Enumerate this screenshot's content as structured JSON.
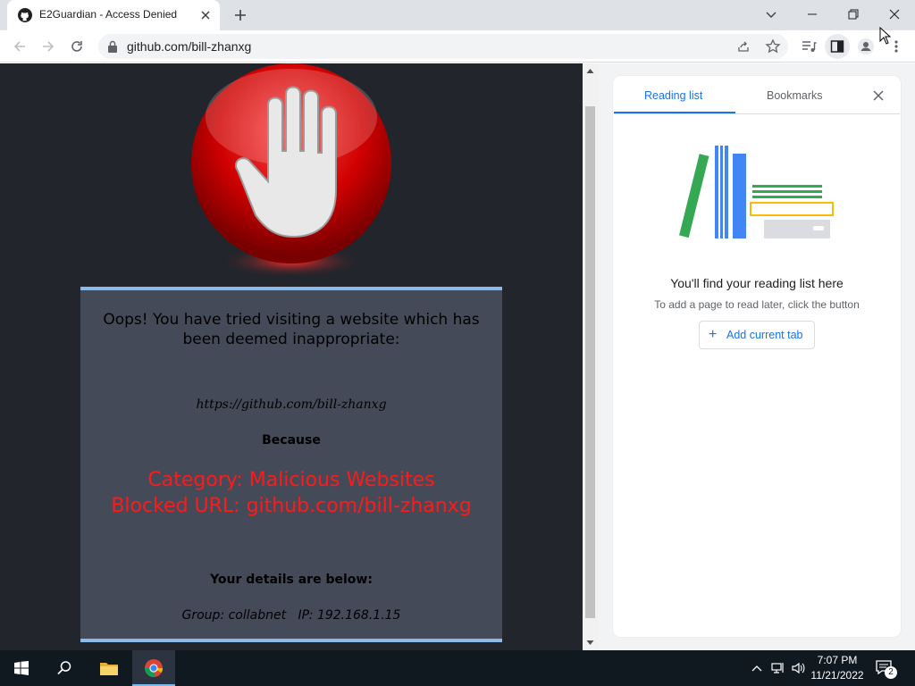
{
  "browser": {
    "tab": {
      "title": "E2Guardian - Access Denied",
      "favicon": "github-icon"
    },
    "address": {
      "url": "github.com/bill-zhanxg"
    }
  },
  "page": {
    "title_line": "Oops! You have tried visiting a website which has been deemed inappropriate:",
    "blocked_url": "https://github.com/bill-zhanxg",
    "because": "Because",
    "category": "Category: Malicious Websites",
    "blocked_url_line": "Blocked URL: github.com/bill-zhanxg",
    "details_heading": "Your details are below:",
    "group_line": "Group: collabnet   IP: 192.168.1.15"
  },
  "side_panel": {
    "tabs": [
      "Reading list",
      "Bookmarks"
    ],
    "active_tab": "Reading list",
    "headline": "You'll find your reading list here",
    "subtext": "To add a page to read later, click the button",
    "button": "Add current tab"
  },
  "taskbar": {
    "time": "7:07 PM",
    "date": "11/21/2022",
    "notifications": "2"
  },
  "colors": {
    "accent": "#1a73e8",
    "blocked_red": "#ff1a1a",
    "page_bg": "#22252b",
    "box_bg": "#454a58",
    "box_border": "#8bb9e8"
  }
}
